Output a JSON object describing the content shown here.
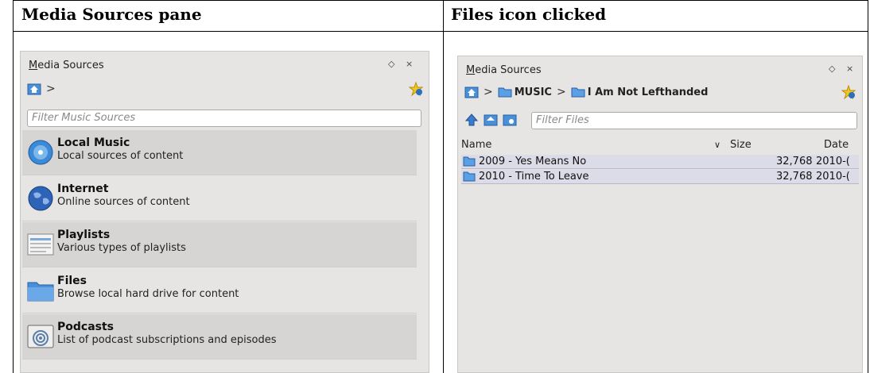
{
  "columns": {
    "left_heading": "Media Sources pane",
    "right_heading": "Files icon clicked"
  },
  "left_panel": {
    "title_first": "M",
    "title_rest": "edia Sources",
    "controls": [
      "◇",
      "×"
    ],
    "breadcrumb_sep": ">",
    "filter_placeholder": "Filter Music Sources",
    "sources": [
      {
        "title": "Local Music",
        "desc": "Local sources of content",
        "icon": "cd-icon"
      },
      {
        "title": "Internet",
        "desc": "Online sources of content",
        "icon": "globe-icon"
      },
      {
        "title": "Playlists",
        "desc": "Various types of playlists",
        "icon": "playlist-icon"
      },
      {
        "title": "Files",
        "desc": "Browse local hard drive for content",
        "icon": "folder-icon"
      },
      {
        "title": "Podcasts",
        "desc": "List of podcast subscriptions and episodes",
        "icon": "podcast-icon"
      }
    ]
  },
  "right_panel": {
    "title_first": "M",
    "title_rest": "edia Sources",
    "controls": [
      "◇",
      "×"
    ],
    "breadcrumb": [
      ">",
      "MUSIC",
      ">",
      "I Am Not Lefthanded"
    ],
    "filter_placeholder": "Filter Files",
    "headers": {
      "name": "Name",
      "sort": "∨",
      "size": "Size",
      "date": "Date"
    },
    "files": [
      {
        "name": "2009 - Yes Means No",
        "size": "32,768",
        "date": "2010-("
      },
      {
        "name": "2010 - Time To Leave",
        "size": "32,768",
        "date": "2010-("
      }
    ]
  },
  "colors": {
    "panel_bg": "#e6e5e4",
    "item_dark": "#d6d5d3",
    "folder_blue": "#4a90d9"
  }
}
